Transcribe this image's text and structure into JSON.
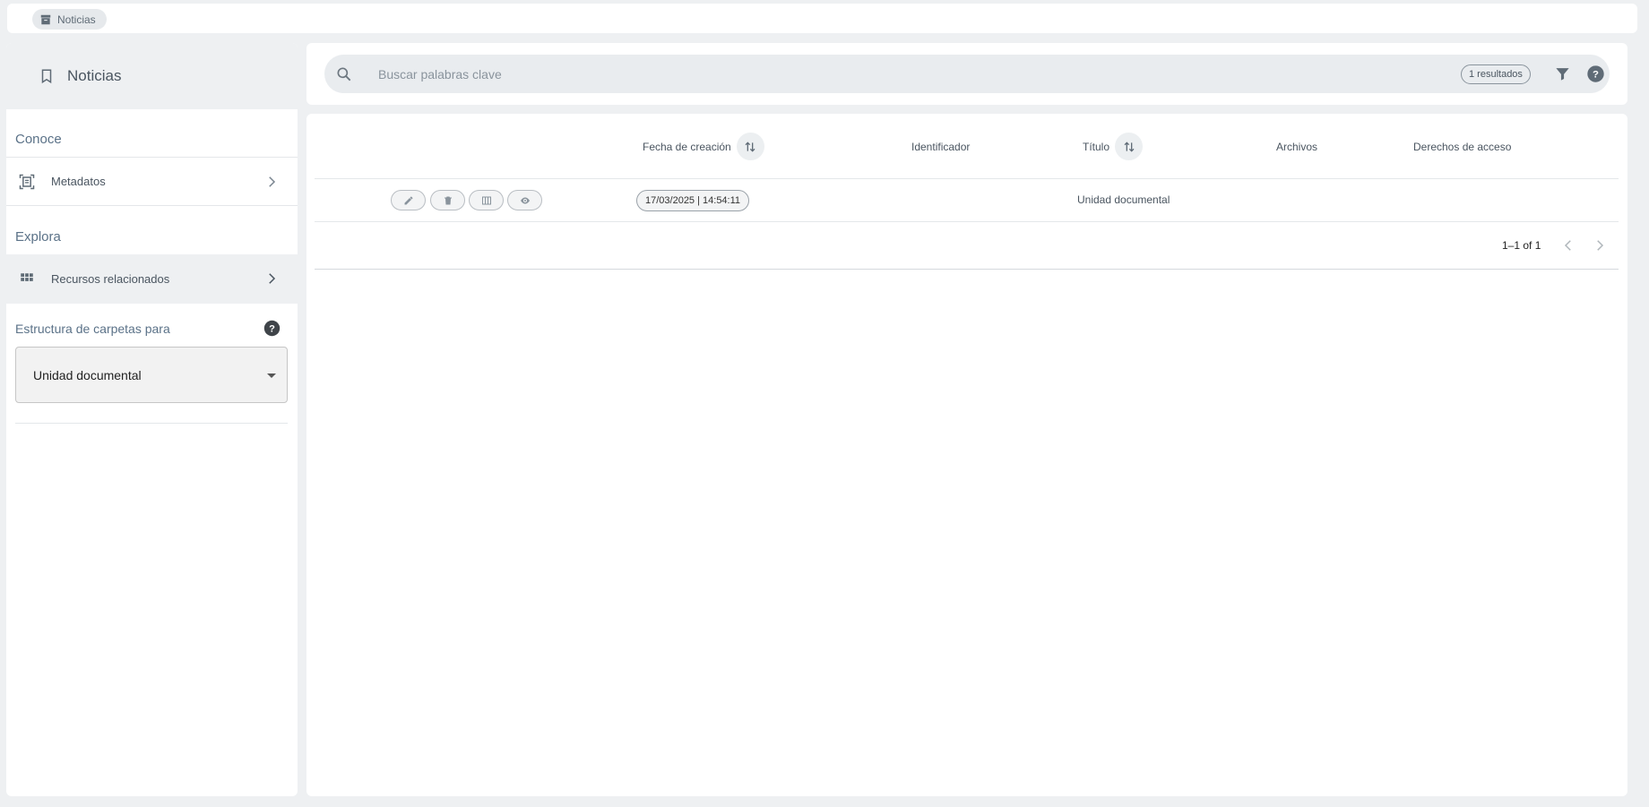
{
  "breadcrumb": {
    "label": "Noticias",
    "icon": "archive-icon"
  },
  "sidebar": {
    "title": "Noticias",
    "title_icon": "bookmark-icon",
    "section_conoce": "Conoce",
    "metadatos_label": "Metadatos",
    "section_explora": "Explora",
    "recursos_label": "Recursos relacionados",
    "folder_label": "Estructura de carpetas para",
    "folder_select_value": "Unidad documental"
  },
  "search": {
    "placeholder": "Buscar palabras clave",
    "results_badge": "1 resultados"
  },
  "table": {
    "columns": {
      "fecha": "Fecha de creación",
      "identificador": "Identificador",
      "titulo": "Título",
      "archivos": "Archivos",
      "derechos": "Derechos de acceso"
    },
    "rows": [
      {
        "fecha": "17/03/2025 | 14:54:11",
        "identificador": "",
        "titulo": "Unidad documental",
        "archivos": "",
        "derechos": ""
      }
    ]
  },
  "pagination": {
    "text": "1–1 of 1"
  },
  "colors": {
    "accent": "#5b7288",
    "panel_bg": "#eef0f2"
  }
}
